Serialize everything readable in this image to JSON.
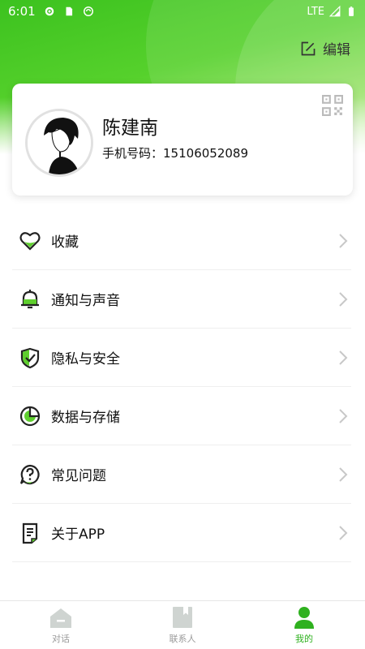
{
  "status_bar": {
    "time": "6:01",
    "network": "LTE"
  },
  "header": {
    "edit_label": "编辑"
  },
  "profile": {
    "name": "陈建南",
    "phone_label": "手机号码：",
    "phone_number": "15106052089"
  },
  "menu": {
    "items": [
      {
        "label": "收藏",
        "icon": "heart-icon"
      },
      {
        "label": "通知与声音",
        "icon": "bell-icon"
      },
      {
        "label": "隐私与安全",
        "icon": "shield-icon"
      },
      {
        "label": "数据与存储",
        "icon": "pie-chart-icon"
      },
      {
        "label": "常见问题",
        "icon": "question-icon"
      },
      {
        "label": "关于APP",
        "icon": "document-icon"
      }
    ]
  },
  "bottom_nav": {
    "items": [
      {
        "label": "对话",
        "icon": "chat-icon"
      },
      {
        "label": "联系人",
        "icon": "contacts-icon"
      },
      {
        "label": "我的",
        "icon": "profile-icon"
      }
    ],
    "active_index": 2
  },
  "colors": {
    "accent": "#3cc21f",
    "active": "#2fb11f",
    "inactive": "#9a9a9a"
  }
}
